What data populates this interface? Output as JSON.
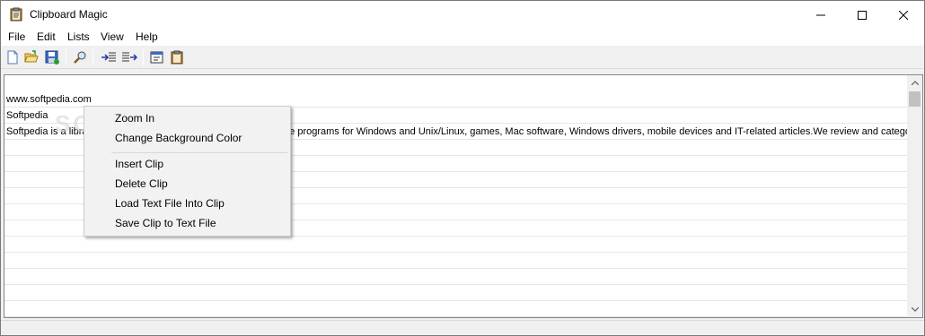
{
  "window": {
    "title": "Clipboard Magic"
  },
  "menu": [
    "File",
    "Edit",
    "Lists",
    "View",
    "Help"
  ],
  "toolbar": {
    "icons": [
      "new-file-icon",
      "open-folder-icon",
      "save-icon",
      "find-icon",
      "indent-in-icon",
      "indent-out-icon",
      "properties-icon",
      "clipboard-icon"
    ]
  },
  "list": {
    "rows": [
      "www.softpedia.com",
      "Softpedia",
      "Softpedia is a libra",
      "",
      "",
      "",
      "",
      "",
      "",
      "",
      "",
      "",
      "",
      "",
      ""
    ],
    "row3_tail": "re programs for Windows and Unix/Linux, games, Mac software, Windows drivers, mobile devices and IT-related articles.We review and catego"
  },
  "context_menu": {
    "items": [
      "Zoom In",
      "Change Background Color",
      "Insert Clip",
      "Delete Clip",
      "Load Text File Into Clip",
      "Save Clip to Text File"
    ]
  },
  "watermark": "SOFTPEDIA",
  "colors": {
    "window_bg": "#f0f0f0",
    "list_bg": "#ffffff",
    "menu_bg": "#f2f2f2",
    "row_line": "#e6e6e6"
  }
}
